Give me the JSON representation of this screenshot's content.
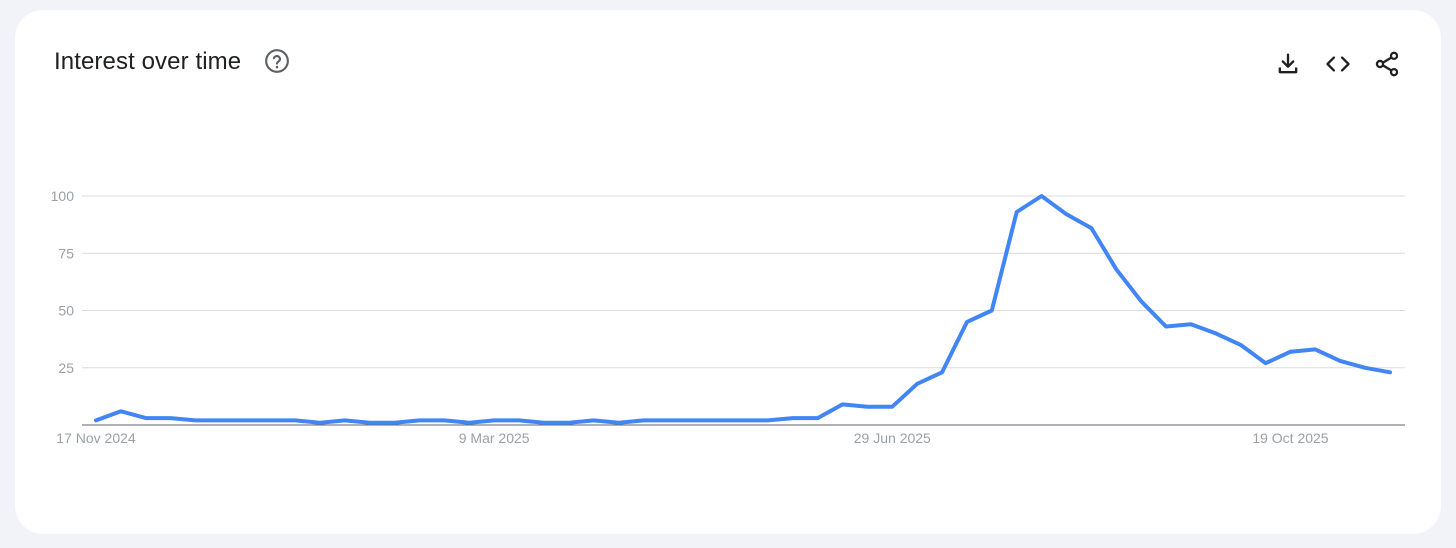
{
  "header": {
    "title": "Interest over time"
  },
  "icons": {
    "help": "help-circle-icon",
    "download": "download-icon",
    "embed": "code-icon",
    "share": "share-icon"
  },
  "colors": {
    "line": "#4285f4",
    "grid": "#dadce0",
    "axis": "#5f6368",
    "tick_text": "#9aa0a6"
  },
  "chart_data": {
    "type": "line",
    "title": "",
    "xlabel": "",
    "ylabel": "",
    "ylim": [
      0,
      100
    ],
    "yticks": [
      25,
      50,
      75,
      100
    ],
    "ytick_labels": [
      "25",
      "50",
      "75",
      "100"
    ],
    "xtick_labels": [
      "17 Nov 2024",
      "9 Mar 2025",
      "29 Jun 2025",
      "19 Oct 2025"
    ],
    "xtick_index": [
      0,
      16,
      32,
      48
    ],
    "grid": true,
    "legend": "none",
    "series": [
      {
        "values": [
          2,
          6,
          3,
          3,
          2,
          2,
          2,
          2,
          2,
          1,
          2,
          1,
          1,
          2,
          2,
          1,
          2,
          2,
          1,
          1,
          2,
          1,
          2,
          2,
          2,
          2,
          2,
          2,
          3,
          3,
          9,
          8,
          8,
          18,
          23,
          45,
          50,
          93,
          100,
          92,
          86,
          68,
          54,
          43,
          44,
          40,
          35,
          27,
          32,
          33,
          28,
          25,
          23
        ]
      }
    ]
  }
}
